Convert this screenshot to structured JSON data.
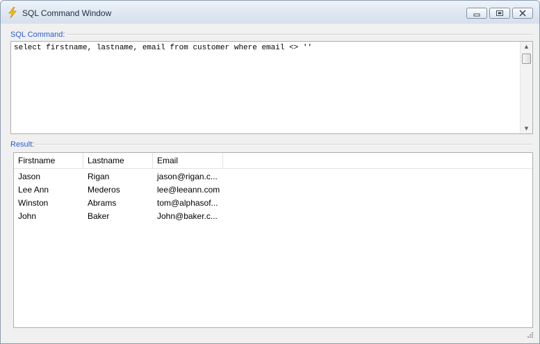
{
  "window": {
    "title": "SQL Command Window",
    "icon": "lightning-bolt-icon",
    "accent": "#2a5ad8"
  },
  "sql": {
    "label": "SQL Command:",
    "query": "select firstname, lastname, email from customer where email <> ''"
  },
  "result": {
    "label": "Result:",
    "columns": [
      "Firstname",
      "Lastname",
      "Email"
    ],
    "rows": [
      [
        "Jason",
        "Rigan",
        "jason@rigan.c..."
      ],
      [
        "Lee Ann",
        "Mederos",
        "lee@leeann.com"
      ],
      [
        "Winston",
        "Abrams",
        "tom@alphasof..."
      ],
      [
        "John",
        "Baker",
        "John@baker.c..."
      ]
    ]
  }
}
